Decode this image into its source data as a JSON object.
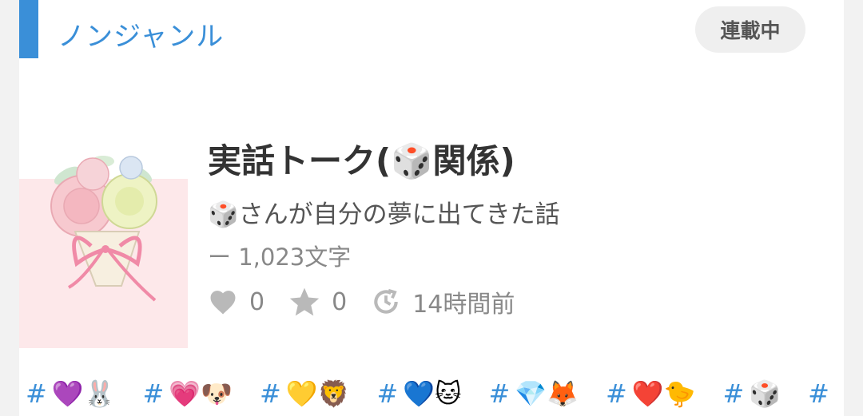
{
  "genre": {
    "label": "ノンジャンル"
  },
  "status": {
    "label": "連載中"
  },
  "work": {
    "title": "実話トーク(🎲関係)",
    "subtitle": "🎲さんが自分の夢に出てきた話",
    "char_count": "ー 1,023文字",
    "likes": "0",
    "stars": "0",
    "updated": "14時間前"
  },
  "tags": [
    {
      "hash": "#",
      "emoji": "💜🐰"
    },
    {
      "hash": "#",
      "emoji": "💗🐶"
    },
    {
      "hash": "#",
      "emoji": "💛🦁"
    },
    {
      "hash": "#",
      "emoji": "💙🐱"
    },
    {
      "hash": "#",
      "emoji": "💎🦊"
    },
    {
      "hash": "#",
      "emoji": "❤️🐤"
    },
    {
      "hash": "#",
      "emoji": "🎲"
    },
    {
      "hash": "#",
      "emoji": ""
    }
  ],
  "colors": {
    "accent": "#3a8fd8",
    "badge_bg": "#efefef",
    "thumb_bg": "#fde8ea"
  },
  "icons": {
    "like": "heart-icon",
    "star": "star-icon",
    "updated": "clock-icon"
  }
}
